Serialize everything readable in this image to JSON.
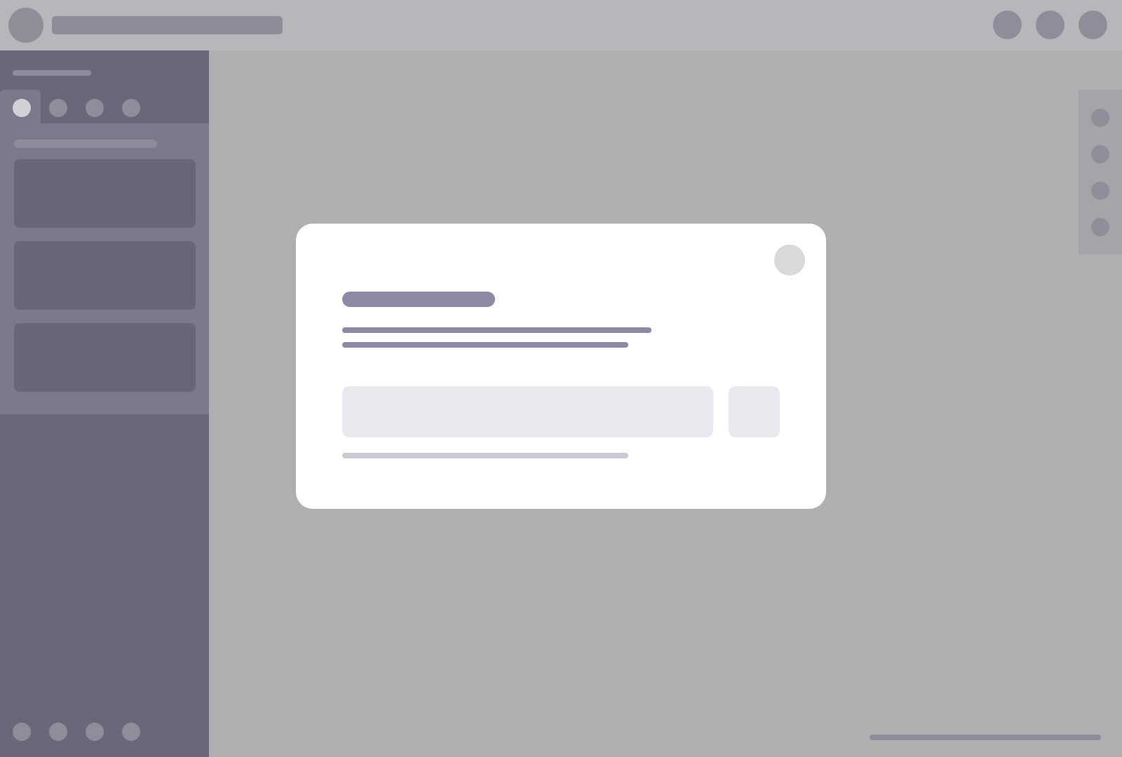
{
  "top_bar": {
    "avatar_icon": "user-avatar-icon",
    "search_placeholder": "",
    "action_icons": [
      "notification-icon",
      "settings-icon",
      "account-icon"
    ]
  },
  "sidebar": {
    "title": "",
    "tabs": [
      {
        "icon": "tab-1-icon",
        "active": true
      },
      {
        "icon": "tab-2-icon",
        "active": false
      },
      {
        "icon": "tab-3-icon",
        "active": false
      },
      {
        "icon": "tab-4-icon",
        "active": false
      }
    ],
    "filter_placeholder": "",
    "cards": [
      "",
      "",
      ""
    ],
    "footer_icons": [
      "footer-icon-1",
      "footer-icon-2",
      "footer-icon-3",
      "footer-icon-4"
    ]
  },
  "right_rail": {
    "icons": [
      "rail-icon-1",
      "rail-icon-2",
      "rail-icon-3",
      "rail-icon-4"
    ]
  },
  "modal": {
    "title": "",
    "body_lines": [
      "",
      ""
    ],
    "input_value": "",
    "input_placeholder": "",
    "action_label": "",
    "hint": "",
    "close_icon": "close-icon"
  },
  "colors": {
    "top_bar": "#b7b6bb",
    "sidebar": "#696778",
    "sidebar_panel": "#7b7a8b",
    "overlay": "#aeafb0",
    "modal": "#ffffff",
    "accent_text": "#8c8aa2",
    "input_bg": "#e8e9ee"
  }
}
